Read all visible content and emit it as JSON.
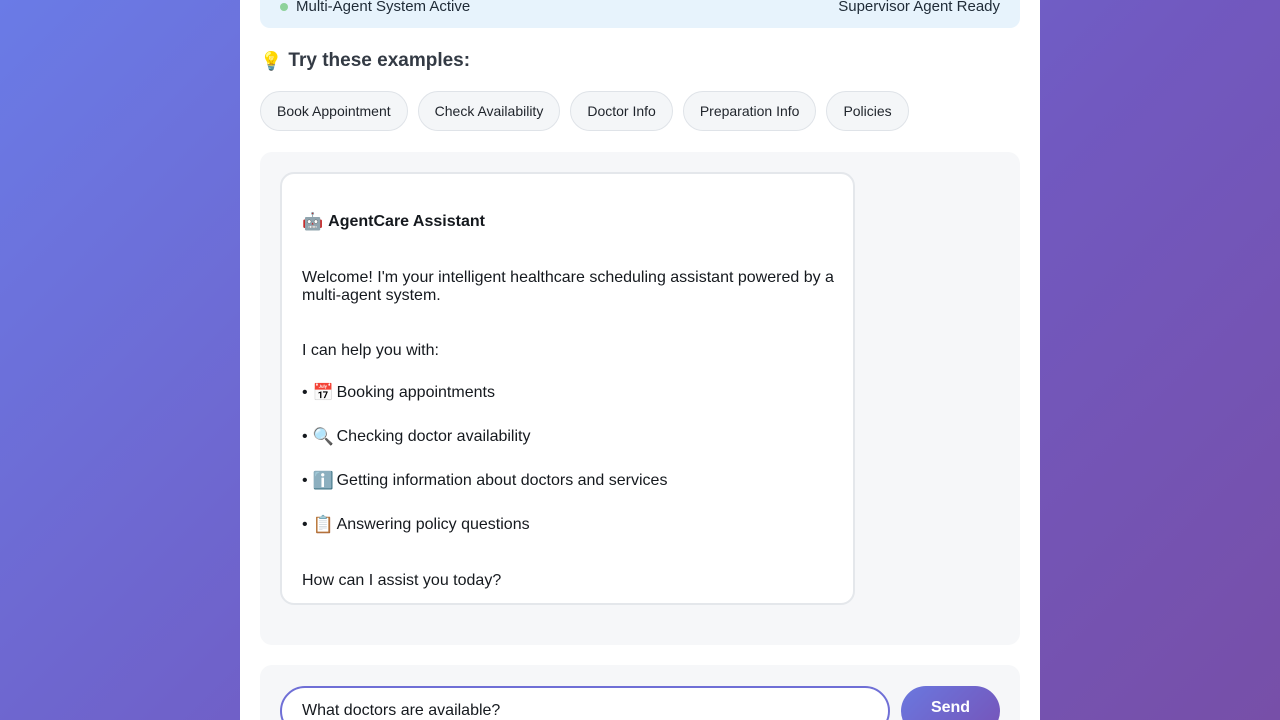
{
  "status": {
    "left_text": "Multi-Agent System Active",
    "right_text": "Supervisor Agent Ready",
    "indicator_color": "#8ed29a"
  },
  "examples": {
    "icon": "lightbulb-icon",
    "heading": "Try these examples:",
    "chips": [
      "Book Appointment",
      "Check Availability",
      "Doctor Info",
      "Preparation Info",
      "Policies"
    ]
  },
  "assistant_message": {
    "icon": "robot-icon",
    "title": "AgentCare Assistant",
    "welcome": "Welcome! I'm your intelligent healthcare scheduling assistant powered by a multi-agent system.",
    "intro": "I can help you with:",
    "features": [
      {
        "icon": "calendar-icon",
        "text": "Booking appointments"
      },
      {
        "icon": "magnifier-icon",
        "text": "Checking doctor availability"
      },
      {
        "icon": "info-icon",
        "text": "Getting information about doctors and services"
      },
      {
        "icon": "clipboard-icon",
        "text": "Answering policy questions"
      }
    ],
    "bullet": "•",
    "closing": "How can I assist you today?"
  },
  "composer": {
    "input_value": "What doctors are available?",
    "send_label": "Send",
    "accent_color": "#6f6fd6"
  }
}
